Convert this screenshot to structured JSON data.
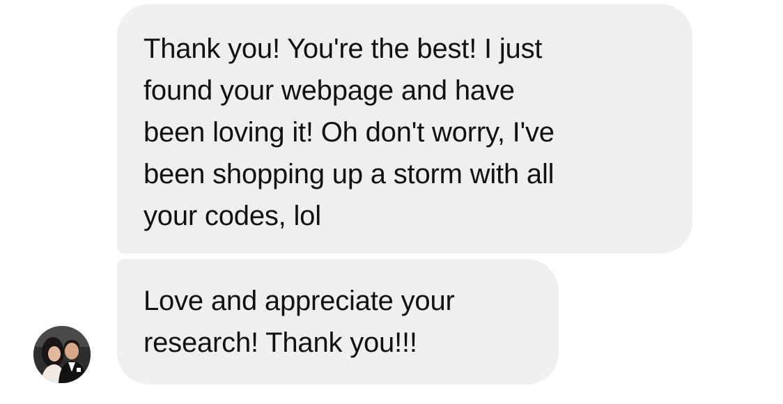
{
  "conversation": {
    "messages": [
      {
        "text": "Thank you! You're the best! I just\nfound your webpage and have\nbeen loving it! Oh don't worry, I've\nbeen shopping up a storm with all\nyour codes, lol"
      },
      {
        "text": "Love and appreciate your\nresearch! Thank you!!!"
      }
    ],
    "avatar": {
      "icon": "profile-photo-icon"
    }
  },
  "colors": {
    "bubble_background": "#efefef",
    "text": "#111111",
    "page_background": "#ffffff"
  }
}
